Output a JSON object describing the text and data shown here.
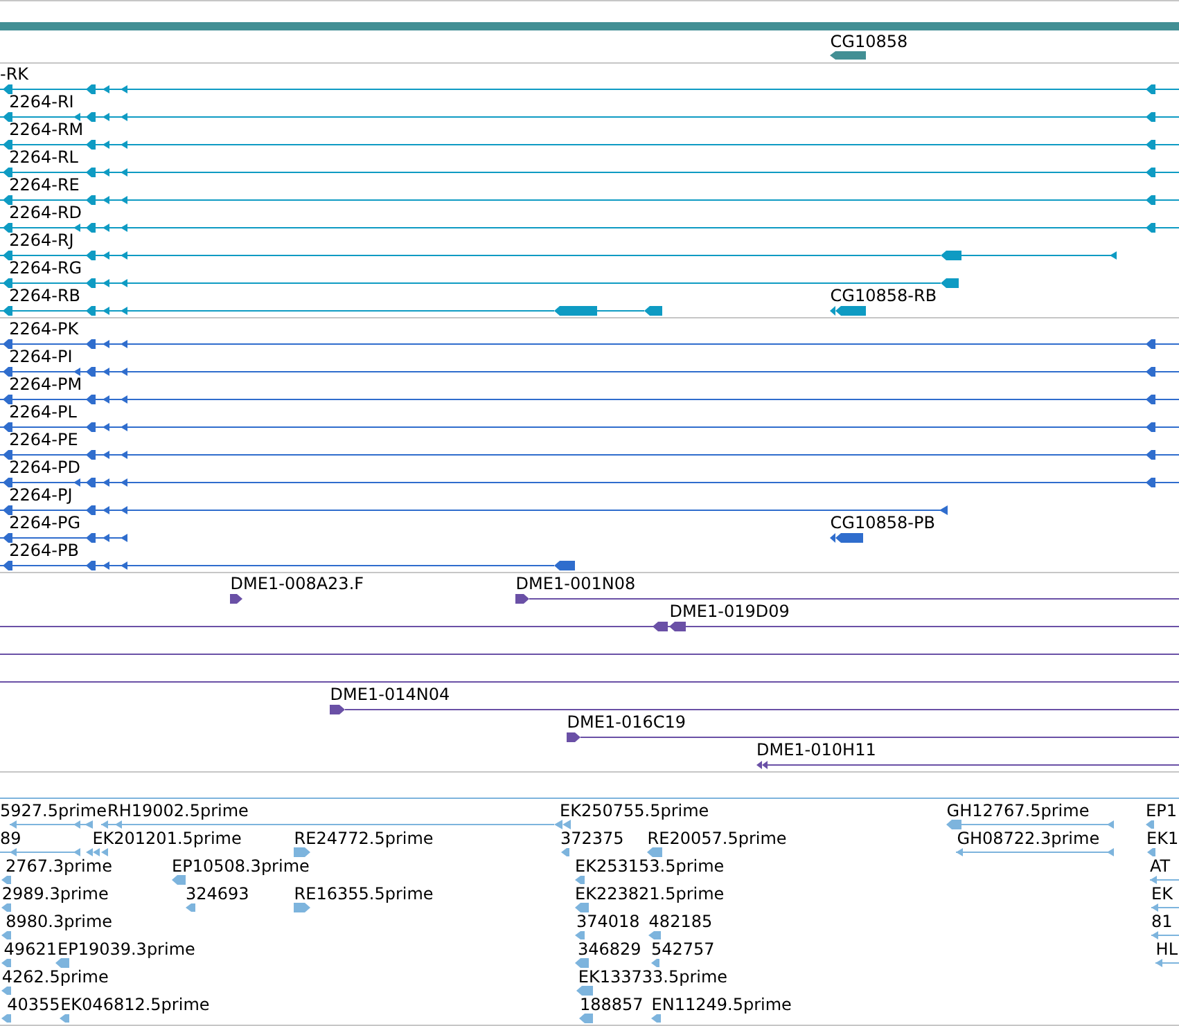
{
  "tracks": [
    {
      "kind": "gene",
      "features": [
        {
          "label": "CG10858"
        }
      ]
    },
    {
      "kind": "transcript",
      "features": [
        {
          "label": "-RK"
        },
        {
          "label": "2264-RI"
        },
        {
          "label": "2264-RM"
        },
        {
          "label": "2264-RL"
        },
        {
          "label": "2264-RE"
        },
        {
          "label": "2264-RD"
        },
        {
          "label": "2264-RJ"
        },
        {
          "label": "2264-RG"
        },
        {
          "label": "2264-RB"
        },
        {
          "label": "CG10858-RB"
        }
      ]
    },
    {
      "kind": "protein",
      "features": [
        {
          "label": "2264-PK"
        },
        {
          "label": "2264-PI"
        },
        {
          "label": "2264-PM"
        },
        {
          "label": "2264-PL"
        },
        {
          "label": "2264-PE"
        },
        {
          "label": "2264-PD"
        },
        {
          "label": "2264-PJ"
        },
        {
          "label": "2264-PG"
        },
        {
          "label": "CG10858-PB"
        },
        {
          "label": "2264-PB"
        }
      ]
    },
    {
      "kind": "clone",
      "features": [
        {
          "label": "DME1-008A23.F"
        },
        {
          "label": "DME1-001N08"
        },
        {
          "label": "DME1-019D09"
        },
        {
          "label": "DME1-014N04"
        },
        {
          "label": "DME1-016C19"
        },
        {
          "label": "DME1-010H11"
        }
      ]
    },
    {
      "kind": "est",
      "features": [
        {
          "label": "5927.5prime"
        },
        {
          "label": "RH19002.5prime"
        },
        {
          "label": "EK250755.5prime"
        },
        {
          "label": "GH12767.5prime"
        },
        {
          "label": "EP1"
        },
        {
          "label": "89"
        },
        {
          "label": "EK201201.5prime"
        },
        {
          "label": "RE24772.5prime"
        },
        {
          "label": "372375"
        },
        {
          "label": "RE20057.5prime"
        },
        {
          "label": "GH08722.3prime"
        },
        {
          "label": "EK1"
        },
        {
          "label": "2767.3prime"
        },
        {
          "label": "EP10508.3prime"
        },
        {
          "label": "EK253153.5prime"
        },
        {
          "label": "AT"
        },
        {
          "label": "2989.3prime"
        },
        {
          "label": "324693"
        },
        {
          "label": "RE16355.5prime"
        },
        {
          "label": "EK223821.5prime"
        },
        {
          "label": "EK"
        },
        {
          "label": "8980.3prime"
        },
        {
          "label": "374018"
        },
        {
          "label": "482185"
        },
        {
          "label": "81"
        },
        {
          "label": "49621"
        },
        {
          "label": "EP19039.3prime"
        },
        {
          "label": "346829"
        },
        {
          "label": "542757"
        },
        {
          "label": "HL"
        },
        {
          "label": "4262.5prime"
        },
        {
          "label": "EK133733.5prime"
        },
        {
          "label": "40355"
        },
        {
          "label": "EK046812.5prime"
        },
        {
          "label": "188857"
        },
        {
          "label": "EN11249.5prime"
        }
      ]
    }
  ]
}
